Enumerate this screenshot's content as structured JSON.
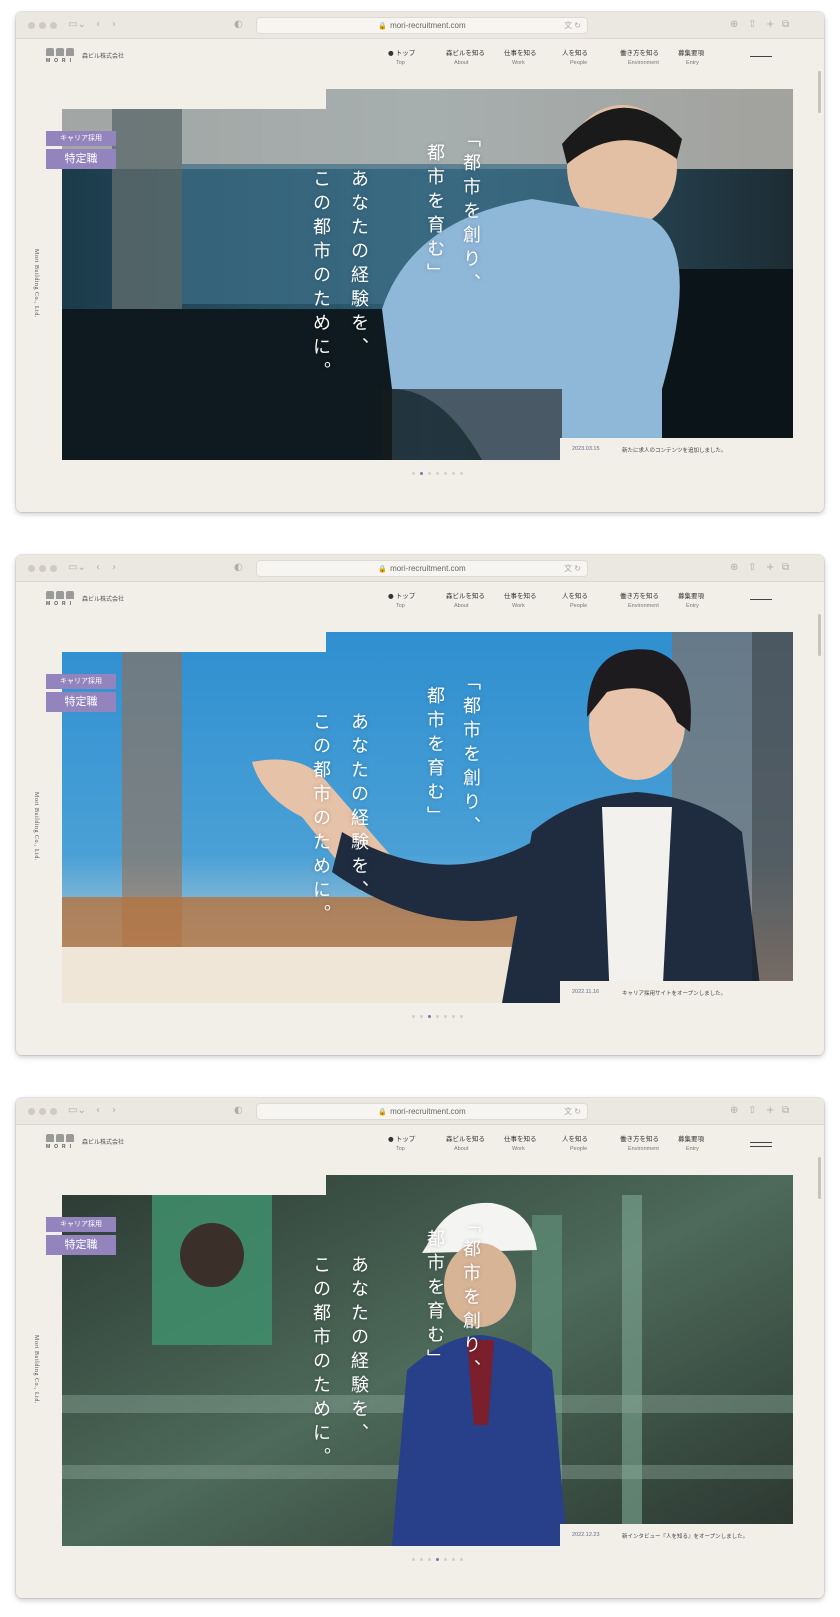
{
  "browser": {
    "url": "mori-recruitment.com"
  },
  "site": {
    "logo_word": "MORI",
    "company": "森ビル株式会社",
    "side_text": "Mori Building Co., Ltd.",
    "nav": [
      {
        "ja": "● トップ",
        "en": "Top"
      },
      {
        "ja": "森ビルを知る",
        "en": "About"
      },
      {
        "ja": "仕事を知る",
        "en": "Work"
      },
      {
        "ja": "人を知る",
        "en": "People"
      },
      {
        "ja": "働き方を知る",
        "en": "Environment"
      },
      {
        "ja": "募集要項",
        "en": "Entry"
      }
    ],
    "tag_small": "キャリア採用",
    "tag_large": "特定職",
    "copy_line1": "「都市を創り、",
    "copy_line2": "都市を育む」",
    "copy_line3": "あなたの経験を、",
    "copy_line4": "この都市のために。"
  },
  "screens": [
    {
      "news_date": "2023.03.15",
      "news_text": "新たに求人のコンテンツを追加しました。",
      "active_slide": 1
    },
    {
      "news_date": "2022.11.16",
      "news_text": "キャリア採用サイトをオープンしました。",
      "active_slide": 2
    },
    {
      "news_date": "2022.12.23",
      "news_text": "新インタビュー『人を知る』をオープンしました。",
      "active_slide": 3
    }
  ],
  "colors": {
    "accent": "#9384bd",
    "page_bg": "#f2efe9"
  }
}
